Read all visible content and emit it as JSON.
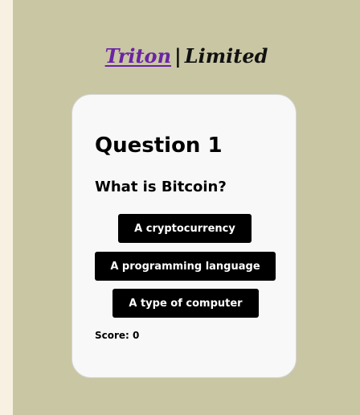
{
  "header": {
    "brand_link": "Triton",
    "separator": "|",
    "brand_suffix": "Limited"
  },
  "quiz": {
    "question_title": "Question 1",
    "question_text": "What is Bitcoin?",
    "answers": [
      "A cryptocurrency",
      "A programming language",
      "A type of computer"
    ],
    "score_label": "Score:",
    "score_value": "0"
  },
  "colors": {
    "page_background": "#c9c6a4",
    "outer_background": "#f8f1e1",
    "card_background": "#f8f8f8",
    "brand_link": "#6a24a4",
    "button_background": "#000000",
    "button_text": "#ffffff"
  }
}
